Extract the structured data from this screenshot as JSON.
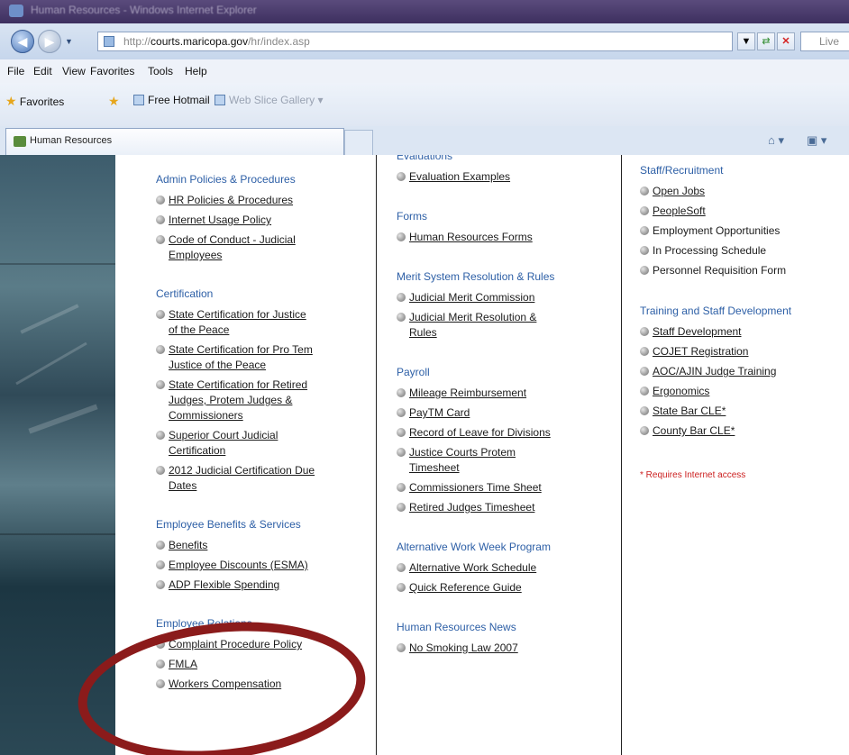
{
  "window": {
    "title": "Human Resources - Windows Internet Explorer"
  },
  "address": {
    "url_prefix": "http://",
    "url_host": "courts.maricopa.gov",
    "url_path": "/hr/index.asp",
    "search_placeholder": "Live"
  },
  "menu": [
    "File",
    "Edit",
    "View",
    "Favorites",
    "Tools",
    "Help"
  ],
  "favorites_bar": {
    "favorites": "Favorites",
    "hotmail": "Free Hotmail",
    "webslice": "Web Slice Gallery"
  },
  "tab": {
    "label": "Human Resources"
  },
  "columns": [
    {
      "sections": [
        {
          "heading": "Admin Policies & Procedures",
          "links": [
            {
              "lines": [
                "HR Policies & Procedures"
              ]
            },
            {
              "lines": [
                "Internet Usage Policy"
              ]
            },
            {
              "lines": [
                "Code of Conduct - Judicial",
                "Employees"
              ]
            }
          ]
        },
        {
          "heading": "Certification",
          "links": [
            {
              "lines": [
                "State Certification for Justice",
                "of the Peace"
              ]
            },
            {
              "lines": [
                "State Certification for Pro Tem",
                "Justice of the Peace"
              ]
            },
            {
              "lines": [
                "State Certification for Retired",
                "Judges, Protem Judges &",
                "Commissioners"
              ]
            },
            {
              "lines": [
                "Superior Court Judicial",
                "Certification"
              ]
            },
            {
              "lines": [
                "2012 Judicial Certification Due",
                "Dates"
              ]
            }
          ]
        },
        {
          "heading": "Employee Benefits & Services",
          "links": [
            {
              "lines": [
                "Benefits"
              ]
            },
            {
              "lines": [
                "Employee Discounts (ESMA)"
              ]
            },
            {
              "lines": [
                "ADP Flexible Spending"
              ]
            }
          ]
        },
        {
          "heading": "Employee Relations",
          "links": [
            {
              "lines": [
                "Complaint Procedure Policy"
              ]
            },
            {
              "lines": [
                "FMLA"
              ]
            },
            {
              "lines": [
                "Workers Compensation"
              ]
            }
          ]
        }
      ]
    },
    {
      "sections": [
        {
          "heading": "Evaluations",
          "links": [
            {
              "lines": [
                "Evaluation Examples"
              ]
            }
          ]
        },
        {
          "heading": "Forms",
          "links": [
            {
              "lines": [
                "Human Resources Forms"
              ]
            }
          ]
        },
        {
          "heading": "Merit System Resolution & Rules",
          "links": [
            {
              "lines": [
                "Judicial Merit Commission"
              ]
            },
            {
              "lines": [
                "Judicial Merit Resolution &",
                "Rules"
              ]
            }
          ]
        },
        {
          "heading": "Payroll",
          "links": [
            {
              "lines": [
                "Mileage Reimbursement"
              ]
            },
            {
              "lines": [
                "PayTM Card"
              ]
            },
            {
              "lines": [
                "Record of Leave for Divisions"
              ]
            },
            {
              "lines": [
                "Justice Courts Protem",
                "Timesheet"
              ]
            },
            {
              "lines": [
                "Commissioners Time Sheet"
              ]
            },
            {
              "lines": [
                "Retired Judges Timesheet"
              ]
            }
          ]
        },
        {
          "heading": "Alternative Work Week Program",
          "links": [
            {
              "lines": [
                "Alternative Work Schedule"
              ]
            },
            {
              "lines": [
                "Quick Reference Guide"
              ]
            }
          ]
        },
        {
          "heading": "Human Resources News",
          "links": [
            {
              "lines": [
                "No Smoking Law 2007"
              ]
            }
          ]
        }
      ]
    },
    {
      "sections": [
        {
          "heading": "Staff/Recruitment",
          "links": [
            {
              "lines": [
                "Open Jobs"
              ]
            },
            {
              "lines": [
                "PeopleSoft"
              ]
            },
            {
              "lines": [
                "Employment Opportunities"
              ],
              "plain": true
            },
            {
              "lines": [
                "In Processing Schedule"
              ],
              "plain": true
            },
            {
              "lines": [
                "Personnel Requisition Form"
              ],
              "plain": true
            }
          ]
        },
        {
          "heading": "Training and Staff Development",
          "links": [
            {
              "lines": [
                "Staff Development"
              ]
            },
            {
              "lines": [
                "COJET Registration"
              ]
            },
            {
              "lines": [
                "AOC/AJIN Judge Training"
              ]
            },
            {
              "lines": [
                "Ergonomics"
              ]
            },
            {
              "lines": [
                "State Bar CLE*"
              ]
            },
            {
              "lines": [
                "County Bar CLE*"
              ]
            }
          ]
        }
      ],
      "note": "* Requires Internet access"
    }
  ]
}
